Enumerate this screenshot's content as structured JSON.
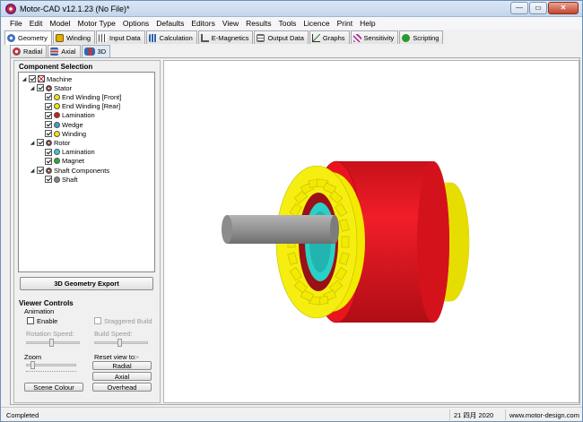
{
  "window": {
    "title": "Motor-CAD v12.1.23 (No File)*",
    "controls": [
      "—",
      "▭",
      "✕"
    ]
  },
  "menu": [
    "File",
    "Edit",
    "Model",
    "Motor Type",
    "Options",
    "Defaults",
    "Editors",
    "View",
    "Results",
    "Tools",
    "Licence",
    "Print",
    "Help"
  ],
  "main_tabs": [
    {
      "label": "Geometry",
      "icon": "geometry-icon",
      "color": "#3a6fc4",
      "active": true
    },
    {
      "label": "Winding",
      "icon": "winding-icon",
      "color": "#e0b000"
    },
    {
      "label": "Input Data",
      "icon": "input-data-icon",
      "color": "#4a4a4a"
    },
    {
      "label": "Calculation",
      "icon": "calculation-icon",
      "color": "#2b5fa8"
    },
    {
      "label": "E-Magnetics",
      "icon": "e-magnetics-icon",
      "color": "#555555"
    },
    {
      "label": "Output Data",
      "icon": "output-data-icon",
      "color": "#666666"
    },
    {
      "label": "Graphs",
      "icon": "graphs-icon",
      "color": "#3a7f3a"
    },
    {
      "label": "Sensitivity",
      "icon": "sensitivity-icon",
      "color": "#b03a9a"
    },
    {
      "label": "Scripting",
      "icon": "scripting-icon",
      "color": "#2a9a2a"
    }
  ],
  "sub_tabs": [
    {
      "label": "Radial",
      "icon": "radial-icon",
      "color": "#c33333"
    },
    {
      "label": "Axial",
      "icon": "axial-icon",
      "color": "#3366aa"
    },
    {
      "label": "3D",
      "icon": "3d-icon",
      "color": "#3366aa",
      "active": true
    }
  ],
  "component_selection": {
    "title": "Component Selection",
    "tree": [
      {
        "label": "Machine",
        "level": 0,
        "expander": "◢",
        "symbol": "machine",
        "color": "#444444"
      },
      {
        "label": "Stator",
        "level": 1,
        "expander": "◢",
        "symbol": "gear",
        "color": "#7a3a3a"
      },
      {
        "label": "End Winding [Front]",
        "level": 2,
        "symbol": "dot",
        "color": "#f2e600"
      },
      {
        "label": "End Winding [Rear]",
        "level": 2,
        "symbol": "dot",
        "color": "#f2e600"
      },
      {
        "label": "Lamination",
        "level": 2,
        "symbol": "dot",
        "color": "#d11a1a"
      },
      {
        "label": "Wedge",
        "level": 2,
        "symbol": "dot",
        "color": "#3fa0d0"
      },
      {
        "label": "Winding",
        "level": 2,
        "symbol": "dot",
        "color": "#f2e600"
      },
      {
        "label": "Rotor",
        "level": 1,
        "expander": "◢",
        "symbol": "gear",
        "color": "#7a3a3a"
      },
      {
        "label": "Lamination",
        "level": 2,
        "symbol": "dot",
        "color": "#2fd0c8"
      },
      {
        "label": "Magnet",
        "level": 2,
        "symbol": "dot",
        "color": "#2aaa3a"
      },
      {
        "label": "Shaft Components",
        "level": 1,
        "expander": "◢",
        "symbol": "gear",
        "color": "#7a3a3a"
      },
      {
        "label": "Shaft",
        "level": 2,
        "symbol": "dot",
        "color": "#888888"
      }
    ]
  },
  "export_button": "3D Geometry Export",
  "viewer_controls": {
    "title": "Viewer Controls",
    "animation_label": "Animation",
    "enable_label": "Enable",
    "staggered_label": "Staggered Build",
    "rotation_speed_label": "Rotation Speed:",
    "build_speed_label": "Build Speed:",
    "zoom_label": "Zoom",
    "reset_label": "Reset view to:-",
    "radial_button": "Radial",
    "axial_button": "Axial",
    "overhead_button": "Overhead",
    "scene_colour_button": "Scene Colour"
  },
  "status": {
    "message": "Completed",
    "date": "21 四月 2020",
    "website": "www.motor-design.com"
  },
  "colors": {
    "stator_lamination": "#e8141e",
    "end_winding": "#f2ea00",
    "rotor": "#2ad0c8",
    "shaft": "#8c8c8c"
  }
}
